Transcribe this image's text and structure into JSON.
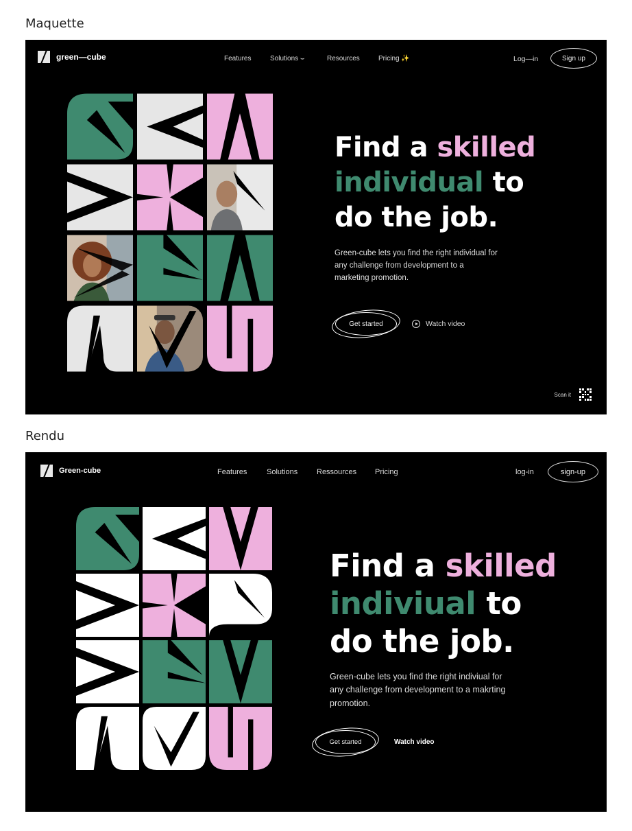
{
  "labels": {
    "maquette": "Maquette",
    "rendu": "Rendu"
  },
  "colors": {
    "green": "#3f8a6f",
    "pink": "#eeb0dd",
    "light": "#e6e6e6",
    "black": "#000000"
  },
  "maquette": {
    "logo": "green—cube",
    "nav": [
      "Features",
      "Solutions",
      "Resources",
      "Pricing"
    ],
    "solutions_icon": "chevron-down-icon",
    "pricing_icon": "sparkle-icon",
    "login": "Log—in",
    "signup": "Sign up",
    "headline": {
      "w1": "Find a",
      "w2": "skilled",
      "w3": "individual",
      "w4": "to",
      "w5": "do the job."
    },
    "paragraph": "Green-cube lets you find the right individual for any challenge from development to a marketing promotion.",
    "cta": "Get started",
    "watch": "Watch video",
    "scan": "Scan it",
    "tiles": [
      "G-green",
      "E-light",
      "A-pink",
      "E-light",
      "K-pink",
      "photo-man",
      "photo-woman",
      "R-green",
      "A-green",
      "N-light",
      "photo-man2",
      "U-pink"
    ]
  },
  "rendu": {
    "logo": "Green-cube",
    "nav": [
      "Features",
      "Solutions",
      "Ressources",
      "Pricing"
    ],
    "login": "log-in",
    "signup": "sign-up",
    "headline": {
      "w1": "Find a",
      "w2": "skilled",
      "w3": "indiviual",
      "w4": "to",
      "w5": "do the job."
    },
    "paragraph": "Green-cube lets you find the right indiviual for any challenge from development to a makrting promotion.",
    "cta": "Get started",
    "watch": "Watch video",
    "tiles": [
      "G-green",
      "E-white",
      "M-pink",
      "E-white",
      "K-pink",
      "P-white",
      "E-white",
      "R-green",
      "M-green",
      "N-white",
      "V-white",
      "W-pink"
    ]
  }
}
